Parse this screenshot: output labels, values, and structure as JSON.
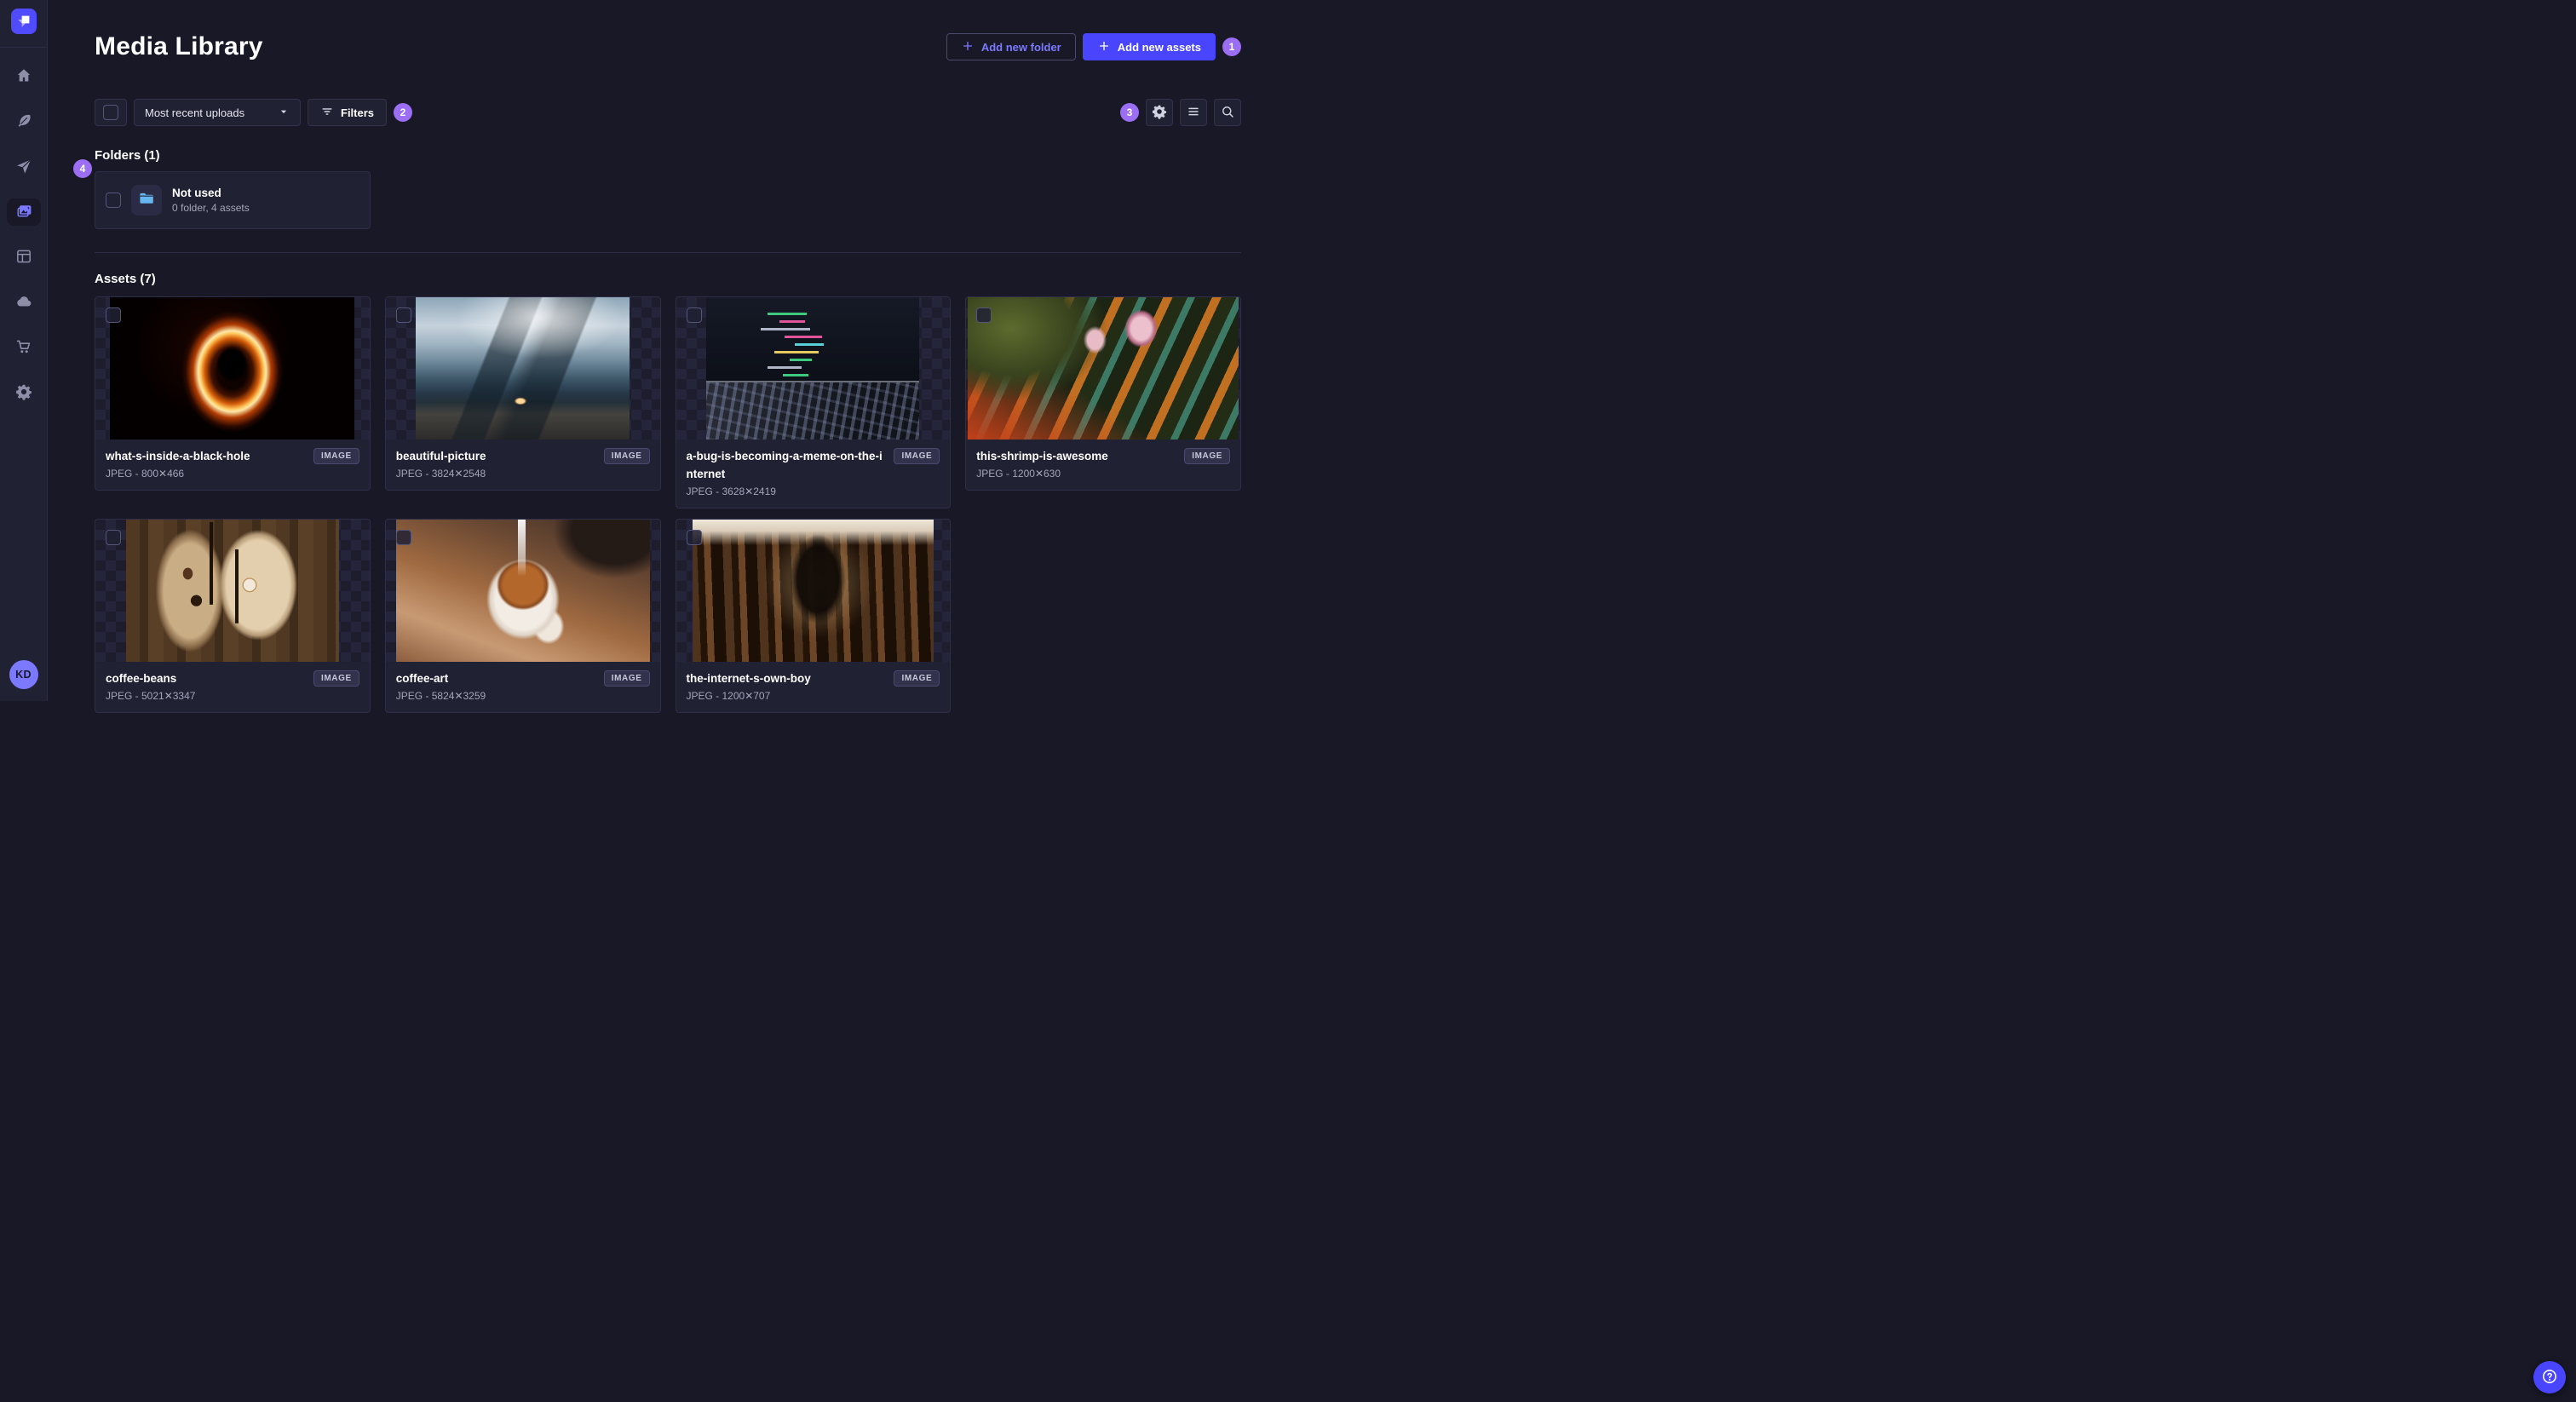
{
  "theme": {
    "page_bg": "#181826",
    "surface_bg": "#212134",
    "primary": "#4945ff",
    "primary_light": "#7b79ff",
    "tour_badge_bg": "#9b6ef3",
    "text_muted": "#a5a5ba",
    "folder_icon_color": "#66b7f1"
  },
  "sidebar": {
    "avatar_initials": "KD",
    "items": [
      {
        "id": "home"
      },
      {
        "id": "content-manager"
      },
      {
        "id": "releases"
      },
      {
        "id": "media-library",
        "active": true
      },
      {
        "id": "content-type-builder"
      },
      {
        "id": "deploy"
      },
      {
        "id": "marketplace"
      },
      {
        "id": "settings"
      }
    ]
  },
  "header": {
    "title": "Media Library",
    "add_folder_label": "Add new folder",
    "add_assets_label": "Add new assets"
  },
  "toolbar": {
    "sort_label": "Most recent uploads",
    "filters_label": "Filters"
  },
  "tour_badges": [
    "1",
    "2",
    "3",
    "4"
  ],
  "folders": {
    "heading": "Folders (1)",
    "items": [
      {
        "name": "Not used",
        "meta": "0 folder, 4 assets"
      }
    ]
  },
  "assets": {
    "heading": "Assets (7)",
    "type_label": "IMAGE",
    "items": [
      {
        "name": "what-s-inside-a-black-hole",
        "meta": "JPEG - 800✕466"
      },
      {
        "name": "beautiful-picture",
        "meta": "JPEG - 3824✕2548"
      },
      {
        "name": "a-bug-is-becoming-a-meme-on-the-internet",
        "meta": "JPEG - 3628✕2419"
      },
      {
        "name": "this-shrimp-is-awesome",
        "meta": "JPEG - 1200✕630"
      },
      {
        "name": "coffee-beans",
        "meta": "JPEG - 5021✕3347"
      },
      {
        "name": "coffee-art",
        "meta": "JPEG - 5824✕3259"
      },
      {
        "name": "the-internet-s-own-boy",
        "meta": "JPEG - 1200✕707"
      }
    ]
  }
}
